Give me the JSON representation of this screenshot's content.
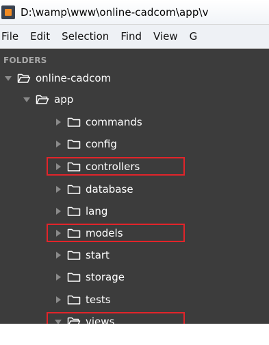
{
  "window": {
    "title": "D:\\wamp\\www\\online-cadcom\\app\\v"
  },
  "menu": [
    "File",
    "Edit",
    "Selection",
    "Find",
    "View",
    "G"
  ],
  "sidebar": {
    "section_label": "FOLDERS",
    "tree": [
      {
        "label": "online-cadcom",
        "level": 0,
        "expanded": true,
        "highlighted": false
      },
      {
        "label": "app",
        "level": 1,
        "expanded": true,
        "highlighted": false
      },
      {
        "label": "commands",
        "level": 2,
        "expanded": false,
        "highlighted": false
      },
      {
        "label": "config",
        "level": 2,
        "expanded": false,
        "highlighted": false
      },
      {
        "label": "controllers",
        "level": 2,
        "expanded": false,
        "highlighted": true
      },
      {
        "label": "database",
        "level": 2,
        "expanded": false,
        "highlighted": false
      },
      {
        "label": "lang",
        "level": 2,
        "expanded": false,
        "highlighted": false
      },
      {
        "label": "models",
        "level": 2,
        "expanded": false,
        "highlighted": true
      },
      {
        "label": "start",
        "level": 2,
        "expanded": false,
        "highlighted": false
      },
      {
        "label": "storage",
        "level": 2,
        "expanded": false,
        "highlighted": false
      },
      {
        "label": "tests",
        "level": 2,
        "expanded": false,
        "highlighted": false
      },
      {
        "label": "views",
        "level": 2,
        "expanded": true,
        "highlighted": true
      }
    ]
  },
  "colors": {
    "sidebar_bg": "#3c3c3c",
    "highlight_border": "#e2242a",
    "text": "#ffffff",
    "arrow": "#8a8a8a"
  }
}
